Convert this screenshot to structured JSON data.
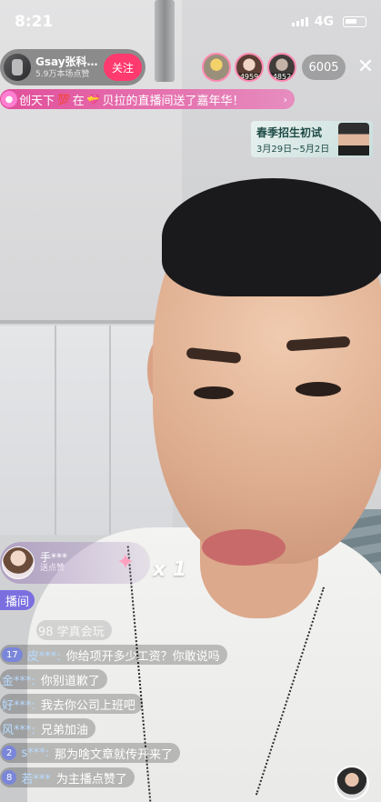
{
  "status_bar": {
    "time": "8:21",
    "network": "4G"
  },
  "host": {
    "name": "Gsay张科…",
    "likes": "5.9万本场点赞",
    "follow_label": "关注"
  },
  "top_viewers": [
    {
      "rank": "",
      "name": "viewer-1"
    },
    {
      "rank": "4959",
      "name": "viewer-2"
    },
    {
      "rank": "4852",
      "name": "viewer-3"
    }
  ],
  "viewer_count": "6005",
  "close_label": "✕",
  "gift_banner": {
    "sender": "创天下",
    "emoji_a": "💯",
    "connector": "在",
    "emoji_b": "💝",
    "text": "贝拉的直播间送了嘉年华！",
    "arrow": "›"
  },
  "promo": {
    "title": "春季招生初试",
    "dates": "3月29日~5月2日"
  },
  "gift_notify": {
    "user": "手***",
    "action": "送点赞",
    "multiplier": "x 1"
  },
  "enter_notice": "播间",
  "chat": [
    {
      "badge": "",
      "name": "",
      "message": "98 学真会玩"
    },
    {
      "badge": "17",
      "name": "皮***:",
      "message": "你给项开多少工资？你敢说吗"
    },
    {
      "badge": "",
      "name": "金***:",
      "message": "你别道歉了"
    },
    {
      "badge": "",
      "name": "好***:",
      "message": "我去你公司上班吧"
    },
    {
      "badge": "",
      "name": "风***:",
      "message": "兄弟加油"
    },
    {
      "badge": "2",
      "name": "s***:",
      "message": "那为啥文章就传开来了"
    },
    {
      "badge": "8",
      "name": "若***",
      "message": "为主播点赞了"
    }
  ],
  "colors": {
    "follow": "#ff3a6e",
    "badge": "#7a86d9",
    "enter": "#7b6fe0"
  }
}
